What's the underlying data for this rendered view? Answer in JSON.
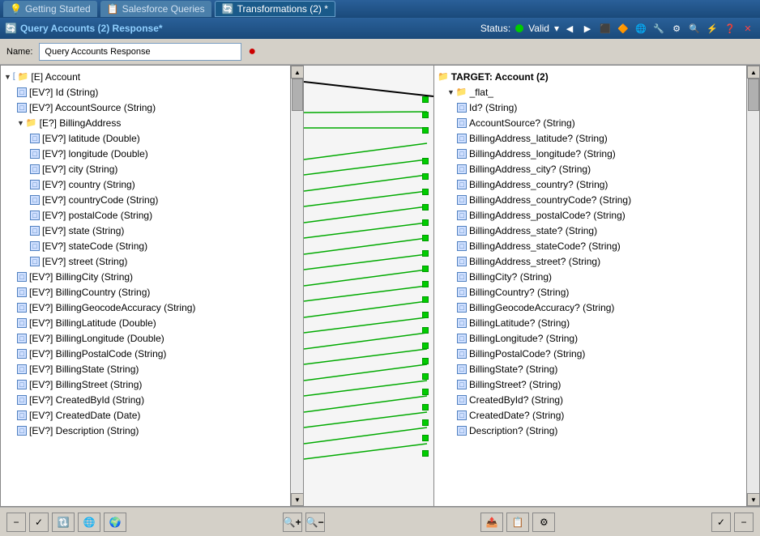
{
  "tabs": [
    {
      "label": "Getting Started",
      "icon": "💡",
      "active": false
    },
    {
      "label": "Salesforce Queries",
      "icon": "📋",
      "active": false
    },
    {
      "label": "Transformations (2) *",
      "icon": "🔄",
      "active": true
    }
  ],
  "toolbar2": {
    "icon": "🔄",
    "title": "Query Accounts (2) Response*",
    "status_label": "Status:",
    "status_value": "Valid",
    "dropdown_arrow": "▾"
  },
  "name_bar": {
    "label": "Name:",
    "value": "Query Accounts Response"
  },
  "left_panel": {
    "root": "[E] Account",
    "nodes": [
      {
        "id": "id",
        "label": "[EV?] Id (String)",
        "indent": 2,
        "connector": true
      },
      {
        "id": "accountsource",
        "label": "[EV?] AccountSource (String)",
        "indent": 2,
        "connector": true
      },
      {
        "id": "billingaddress",
        "label": "[E?] BillingAddress",
        "indent": 2,
        "is_folder": true
      },
      {
        "id": "latitude",
        "label": "[EV?] latitude (Double)",
        "indent": 3,
        "connector": true
      },
      {
        "id": "longitude",
        "label": "[EV?] longitude (Double)",
        "indent": 3,
        "connector": true
      },
      {
        "id": "city",
        "label": "[EV?] city (String)",
        "indent": 3,
        "connector": true
      },
      {
        "id": "country",
        "label": "[EV?] country (String)",
        "indent": 3,
        "connector": true
      },
      {
        "id": "countrycode",
        "label": "[EV?] countryCode (String)",
        "indent": 3,
        "connector": true
      },
      {
        "id": "postalcode",
        "label": "[EV?] postalCode (String)",
        "indent": 3,
        "connector": true
      },
      {
        "id": "state",
        "label": "[EV?] state (String)",
        "indent": 3,
        "connector": true
      },
      {
        "id": "statecode",
        "label": "[EV?] stateCode (String)",
        "indent": 3,
        "connector": true
      },
      {
        "id": "street",
        "label": "[EV?] street (String)",
        "indent": 3,
        "connector": true
      },
      {
        "id": "billingcity",
        "label": "[EV?] BillingCity (String)",
        "indent": 2,
        "connector": true
      },
      {
        "id": "billingcountry",
        "label": "[EV?] BillingCountry (String)",
        "indent": 2,
        "connector": true
      },
      {
        "id": "billinggeocode",
        "label": "[EV?] BillingGeocodeAccuracy (String)",
        "indent": 2,
        "connector": true
      },
      {
        "id": "billinglatitude",
        "label": "[EV?] BillingLatitude (Double)",
        "indent": 2,
        "connector": true
      },
      {
        "id": "billinglongitude",
        "label": "[EV?] BillingLongitude (Double)",
        "indent": 2,
        "connector": true
      },
      {
        "id": "billingpostal",
        "label": "[EV?] BillingPostalCode (String)",
        "indent": 2,
        "connector": true
      },
      {
        "id": "billingstate",
        "label": "[EV?] BillingState (String)",
        "indent": 2,
        "connector": true
      },
      {
        "id": "billingstreet",
        "label": "[EV?] BillingStreet (String)",
        "indent": 2,
        "connector": true
      },
      {
        "id": "createdbyid",
        "label": "[EV?] CreatedById (String)",
        "indent": 2,
        "connector": true
      },
      {
        "id": "createddate",
        "label": "[EV?] CreatedDate (Date)",
        "indent": 2,
        "connector": true
      },
      {
        "id": "description",
        "label": "[EV?] Description (String)",
        "indent": 2,
        "connector": true
      }
    ]
  },
  "right_panel": {
    "target_header": "TARGET: Account (2)",
    "flat_node": "_flat_",
    "nodes": [
      {
        "label": "Id? (String)"
      },
      {
        "label": "AccountSource? (String)"
      },
      {
        "label": "BillingAddress_latitude? (String)"
      },
      {
        "label": "BillingAddress_longitude? (String)"
      },
      {
        "label": "BillingAddress_city? (String)"
      },
      {
        "label": "BillingAddress_country? (String)"
      },
      {
        "label": "BillingAddress_countryCode? (String)"
      },
      {
        "label": "BillingAddress_postalCode? (String)"
      },
      {
        "label": "BillingAddress_state? (String)"
      },
      {
        "label": "BillingAddress_stateCode? (String)"
      },
      {
        "label": "BillingAddress_street? (String)"
      },
      {
        "label": "BillingCity? (String)"
      },
      {
        "label": "BillingCountry? (String)"
      },
      {
        "label": "BillingGeocodeAccuracy? (String)"
      },
      {
        "label": "BillingLatitude? (String)"
      },
      {
        "label": "BillingLongitude? (String)"
      },
      {
        "label": "BillingPostalCode? (String)"
      },
      {
        "label": "BillingState? (String)"
      },
      {
        "label": "BillingStreet? (String)"
      },
      {
        "label": "CreatedById? (String)"
      },
      {
        "label": "CreatedDate? (String)"
      },
      {
        "label": "Description? (String)"
      }
    ]
  },
  "bottom_toolbar": {
    "collapse_label": "−",
    "validate_label": "✓",
    "zoom_in_label": "+",
    "zoom_out_label": "−"
  }
}
